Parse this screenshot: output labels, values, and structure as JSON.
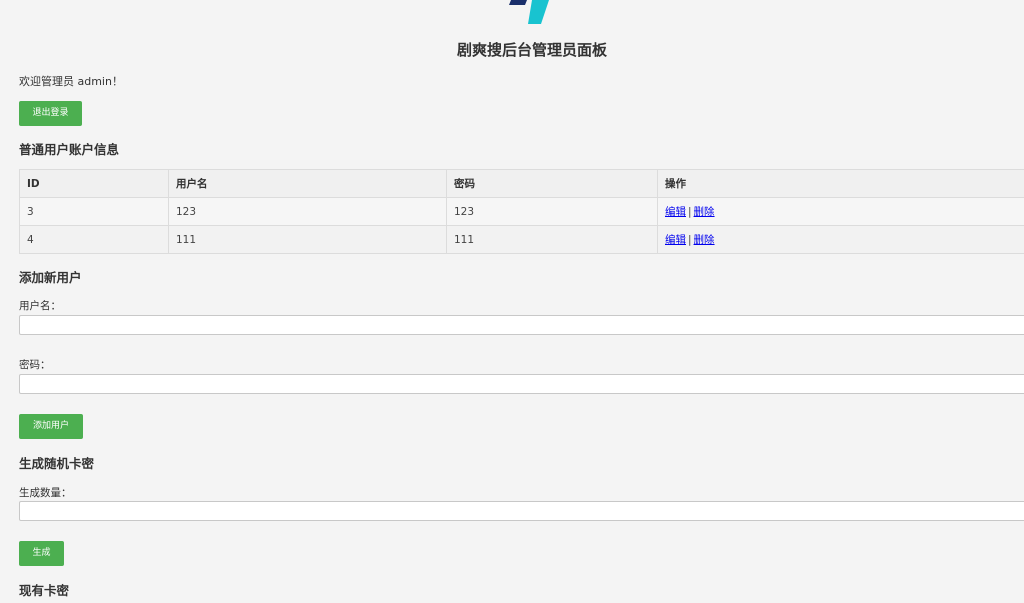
{
  "header": {
    "title": "剧爽搜后台管理员面板",
    "welcome": "欢迎管理员 admin！"
  },
  "buttons": {
    "logout": "退出登录",
    "add_user": "添加用户",
    "generate": "生成"
  },
  "users_section": {
    "title": "普通用户账户信息",
    "columns": [
      "ID",
      "用户名",
      "密码",
      "操作"
    ],
    "rows": [
      {
        "id": "3",
        "username": "123",
        "password": "123",
        "edit": "编辑",
        "delete": "删除"
      },
      {
        "id": "4",
        "username": "111",
        "password": "111",
        "edit": "编辑",
        "delete": "删除"
      }
    ],
    "separator": "|"
  },
  "add_user_section": {
    "title": "添加新用户",
    "username_label": "用户名：",
    "password_label": "密码：",
    "username_value": "",
    "password_value": ""
  },
  "generate_section": {
    "title": "生成随机卡密",
    "count_label": "生成数量：",
    "count_value": ""
  },
  "cards_section": {
    "title": "现有卡密"
  },
  "colors": {
    "background": "#f4f4f4",
    "button": "#4caf50",
    "link": "#0000ee",
    "logo_dark": "#1a2f6b",
    "logo_cyan": "#18c3d0"
  },
  "icons": {
    "logo": "brand-logo-icon"
  }
}
